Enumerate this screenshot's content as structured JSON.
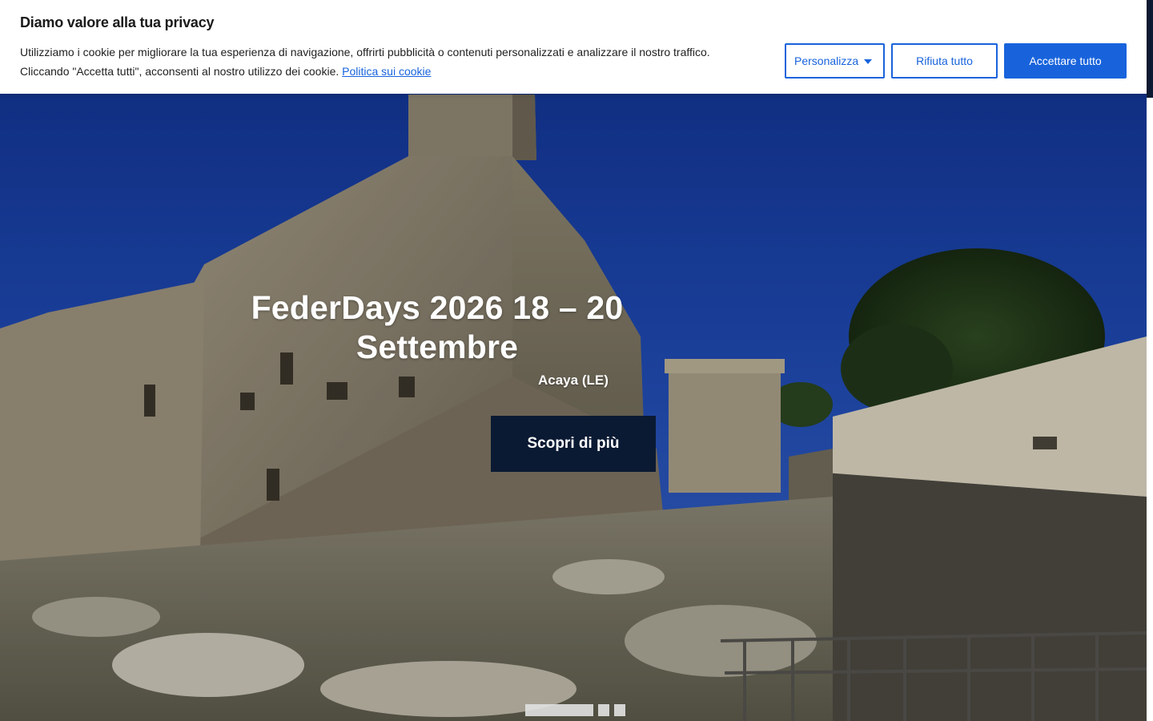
{
  "cookie_banner": {
    "title": "Diamo valore alla tua privacy",
    "text_line1": "Utilizziamo i cookie per migliorare la tua esperienza di navigazione, offrirti pubblicità o contenuti personalizzati e analizzare il nostro traffico.",
    "text_line2": "Cliccando \"Accetta tutti\", acconsenti al nostro utilizzo dei cookie.",
    "policy_link": "Politica sui cookie",
    "customize_label": "Personalizza",
    "reject_label": "Rifiuta tutto",
    "accept_label": "Accettare tutto",
    "accent_color": "#1863dc"
  },
  "hero": {
    "title": "FederDays 2026 18 – 20 Settembre",
    "subtitle": "Acaya (LE)",
    "cta_label": "Scopri di più",
    "cta_color": "#0b1a33",
    "slides_total": 3,
    "active_slide": 1,
    "background": "castle-photo"
  }
}
